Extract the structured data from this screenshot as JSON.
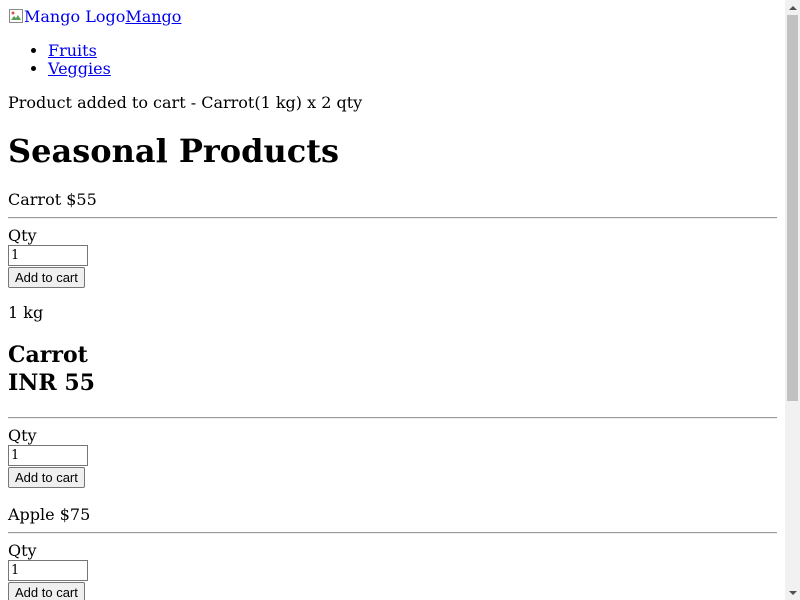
{
  "header": {
    "logo_alt": "Mango Logo",
    "brand_name": "Mango"
  },
  "nav": {
    "items": [
      {
        "label": "Fruits"
      },
      {
        "label": "Veggies"
      }
    ]
  },
  "notice": "Product added to cart - Carrot(1 kg) x 2 qty",
  "page_title": "Seasonal Products",
  "products": [
    {
      "summary": "Carrot $55",
      "qty_label": "Qty",
      "qty_value": "1",
      "add_label": "Add to cart",
      "weight": "1 kg",
      "detail_name": "Carrot",
      "detail_price": "INR 55"
    },
    {
      "qty_label": "Qty",
      "qty_value": "1",
      "add_label": "Add to cart"
    },
    {
      "summary": "Apple $75",
      "qty_label": "Qty",
      "qty_value": "1",
      "add_label": "Add to cart"
    }
  ],
  "colors": {
    "link": "#0000ee",
    "scroll_track": "#f1f1f1",
    "scroll_thumb": "#c1c1c1"
  },
  "icons": {
    "broken_image": "broken-image-icon",
    "scroll_up": "scroll-up-arrow-icon",
    "scroll_down": "scroll-down-arrow-icon"
  }
}
